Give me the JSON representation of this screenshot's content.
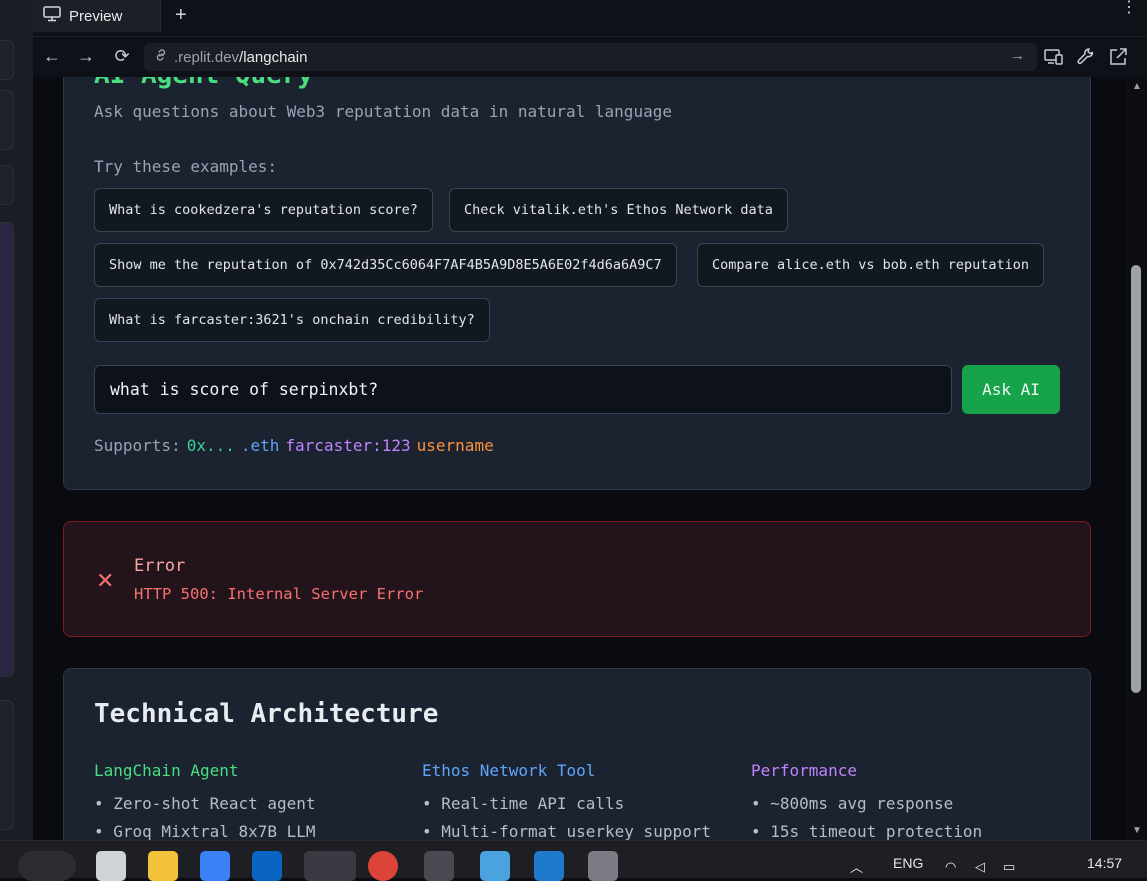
{
  "browser": {
    "tab_label": "Preview",
    "new_tab_symbol": "+",
    "url_domain": ".replit.dev",
    "url_path": "/langchain"
  },
  "query": {
    "title": "AI Agent Query",
    "subtitle": "Ask questions about Web3 reputation data in natural language",
    "examples_label": "Try these examples:",
    "examples": [
      "What is cookedzera's reputation score?",
      "Check vitalik.eth's Ethos Network data",
      "Show me the reputation of 0x742d35Cc6064F7AF4B5A9D8E5A6E02f4d6a6A9C7",
      "Compare alice.eth vs bob.eth reputation",
      "What is farcaster:3621's onchain credibility?"
    ],
    "input_value": "what is score of serpinxbt?",
    "ask_button": "Ask AI",
    "supports_label": "Supports:",
    "supports": [
      {
        "text": "0x...",
        "color": "#34d399"
      },
      {
        "text": ".eth",
        "color": "#60a5fa"
      },
      {
        "text": "farcaster:123",
        "color": "#c084fc"
      },
      {
        "text": "username",
        "color": "#fb923c"
      }
    ]
  },
  "error": {
    "title": "Error",
    "message": "HTTP 500: Internal Server Error"
  },
  "architecture": {
    "title": "Technical Architecture",
    "columns": [
      {
        "heading": "LangChain Agent",
        "color": "#4ade80",
        "items": [
          "Zero-shot React agent",
          "Groq Mixtral 8x7B LLM"
        ]
      },
      {
        "heading": "Ethos Network Tool",
        "color": "#60a5fa",
        "items": [
          "Real-time API calls",
          "Multi-format userkey support"
        ]
      },
      {
        "heading": "Performance",
        "color": "#c084fc",
        "items": [
          "~800ms avg response",
          "15s timeout protection"
        ]
      }
    ]
  },
  "taskbar": {
    "language": "ENG",
    "time": "14:57"
  }
}
